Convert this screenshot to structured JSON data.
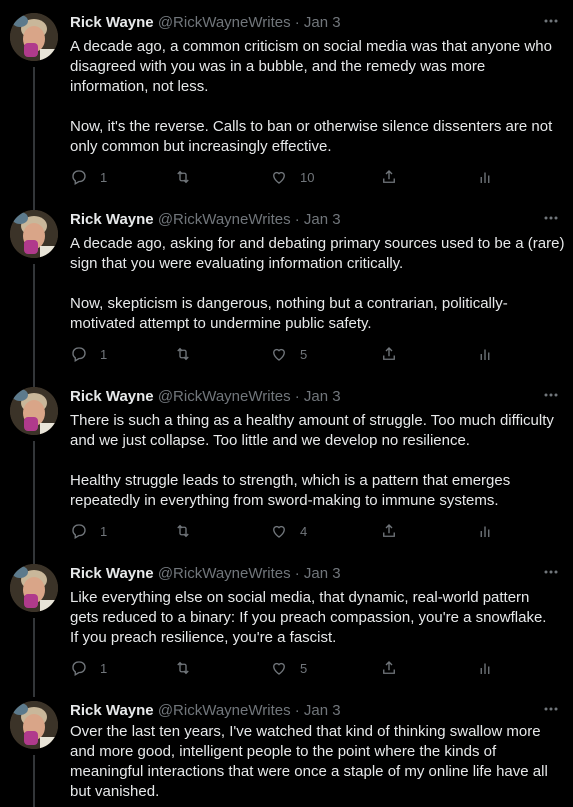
{
  "colors": {
    "background": "#000000",
    "text": "#e7e9ea",
    "muted": "#71767b",
    "thread_line": "#333639"
  },
  "tweets": [
    {
      "author": "Rick Wayne",
      "handle": "@RickWayneWrites",
      "separator": "·",
      "date": "Jan 3",
      "lines": [
        "A decade ago, a common criticism on social media was that anyone who",
        "disagreed with you was in a bubble, and the remedy was more",
        "information, not less.",
        "",
        "Now, it's the reverse. Calls to ban or otherwise silence dissenters are not",
        "only common but increasingly effective."
      ],
      "replies": "1",
      "retweets": "",
      "likes": "10",
      "icons": [
        "more-icon",
        "reply-icon",
        "retweet-icon",
        "like-icon",
        "share-icon",
        "analytics-icon"
      ]
    },
    {
      "author": "Rick Wayne",
      "handle": "@RickWayneWrites",
      "separator": "·",
      "date": "Jan 3",
      "lines": [
        "A decade ago, asking for and debating primary sources used to be a (rare)",
        "sign that you were evaluating information critically.",
        "",
        "Now, skepticism is dangerous, nothing but a contrarian, politically-",
        "motivated attempt to undermine public safety."
      ],
      "replies": "1",
      "retweets": "",
      "likes": "5"
    },
    {
      "author": "Rick Wayne",
      "handle": "@RickWayneWrites",
      "separator": "·",
      "date": "Jan 3",
      "lines": [
        "There is such a thing as a healthy amount of struggle. Too much difficulty",
        "and we just collapse. Too little and we develop no resilience.",
        "",
        "Healthy struggle leads to strength, which is a pattern that emerges",
        "repeatedly in everything from sword-making to immune systems."
      ],
      "replies": "1",
      "retweets": "",
      "likes": "4"
    },
    {
      "author": "Rick Wayne",
      "handle": "@RickWayneWrites",
      "separator": "·",
      "date": "Jan 3",
      "lines": [
        "Like everything else on social media, that dynamic, real-world pattern",
        "gets reduced to a binary: If you preach compassion, you're a snowflake.",
        "If you preach resilience, you're a fascist."
      ],
      "replies": "1",
      "retweets": "",
      "likes": "5"
    },
    {
      "author": "Rick Wayne",
      "handle": "@RickWayneWrites",
      "separator": "·",
      "date": "Jan 3",
      "lines": [
        "Over the last ten years, I've watched that kind of thinking swallow more",
        "and more good, intelligent people to the point where the kinds of",
        "meaningful interactions that were once a staple of my online life have all",
        "but vanished."
      ],
      "replies": "",
      "retweets": "",
      "likes": ""
    }
  ]
}
